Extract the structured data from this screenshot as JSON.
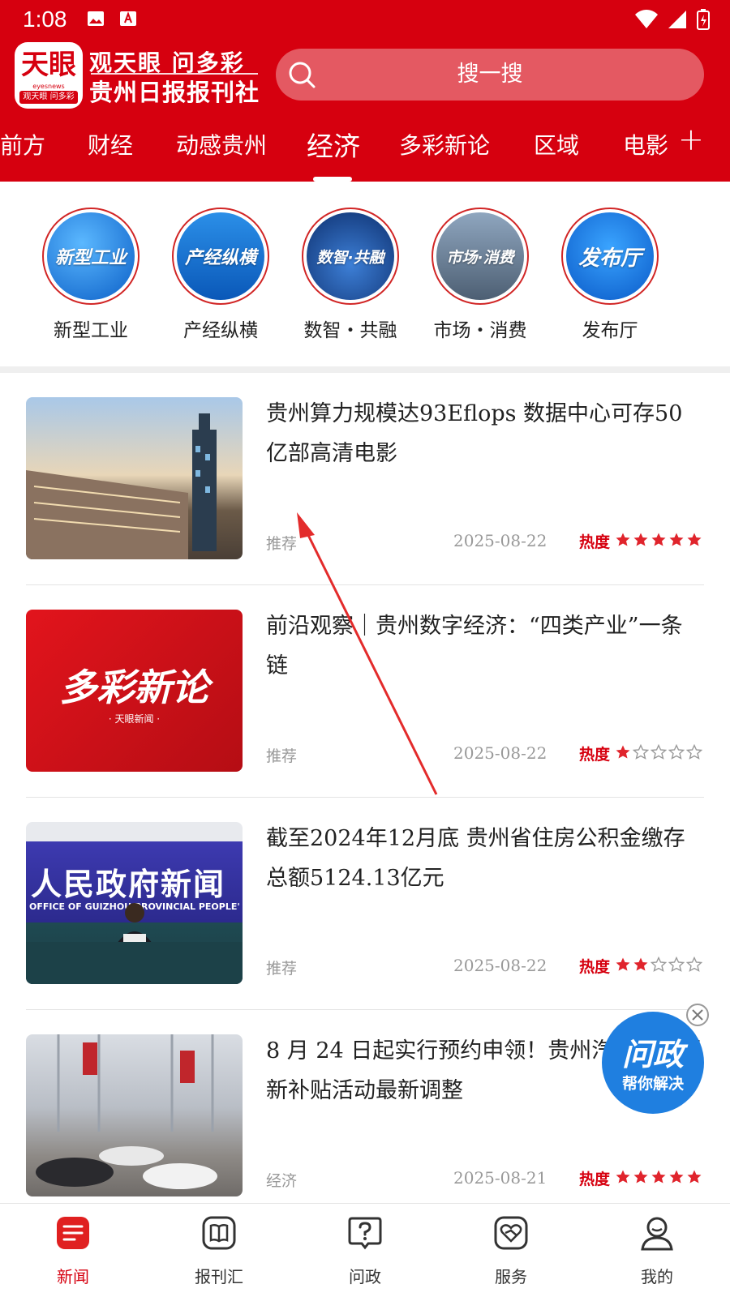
{
  "status_bar": {
    "time": "1:08"
  },
  "header": {
    "logo_text": "天眼",
    "logo_sub": "eyesnews",
    "logo_bar": "观天眼 问多彩",
    "brand_line1": "观天眼 问多彩",
    "brand_line2": "贵州日报报刊社",
    "search_placeholder": "搜一搜",
    "accent_color": "#d6000f"
  },
  "tabs": [
    {
      "label": "前方"
    },
    {
      "label": "财经"
    },
    {
      "label": "动感贵州"
    },
    {
      "label": "经济",
      "active": true
    },
    {
      "label": "多彩新论"
    },
    {
      "label": "区域"
    },
    {
      "label": "电影"
    }
  ],
  "tabs_add": "+",
  "categories": [
    {
      "label": "新型工业",
      "badge": "新型工业"
    },
    {
      "label": "产经纵横",
      "badge": "产经纵横"
    },
    {
      "label": "数智・共融",
      "badge": "数智·共融"
    },
    {
      "label": "市场・消费",
      "badge": "市场·消费"
    },
    {
      "label": "发布厅",
      "badge": "发布厅"
    }
  ],
  "news": [
    {
      "title": "贵州算力规模达93Eflops 数据中心可存50亿部高清电影",
      "tag": "推荐",
      "date": "2025-08-22",
      "heat_label": "热度",
      "heat": 5
    },
    {
      "title": "前沿观察｜贵州数字经济：“四类产业”一条链",
      "tag": "推荐",
      "date": "2025-08-22",
      "heat_label": "热度",
      "heat": 1,
      "thumb_text": "多彩新论",
      "thumb_sub": "· 天眼新闻 ·"
    },
    {
      "title": "截至2024年12月底 贵州省住房公积金缴存总额5124.13亿元",
      "tag": "推荐",
      "date": "2025-08-22",
      "heat_label": "热度",
      "heat": 2,
      "thumb_text": "人民政府新闻",
      "thumb_sub": "OFFICE OF GUIZHOU PROVINCIAL PEOPLE'"
    },
    {
      "title": "8 月 24 日起实行预约申领！贵州汽车置换更新补贴活动最新调整",
      "tag": "经济",
      "date": "2025-08-21",
      "heat_label": "热度",
      "heat": 5
    }
  ],
  "floating": {
    "title": "问政",
    "subtitle": "帮你解决"
  },
  "bottom_nav": [
    {
      "label": "新闻",
      "icon": "news-icon",
      "active": true
    },
    {
      "label": "报刊汇",
      "icon": "book-icon"
    },
    {
      "label": "问政",
      "icon": "question-icon"
    },
    {
      "label": "服务",
      "icon": "service-icon"
    },
    {
      "label": "我的",
      "icon": "profile-icon"
    }
  ]
}
